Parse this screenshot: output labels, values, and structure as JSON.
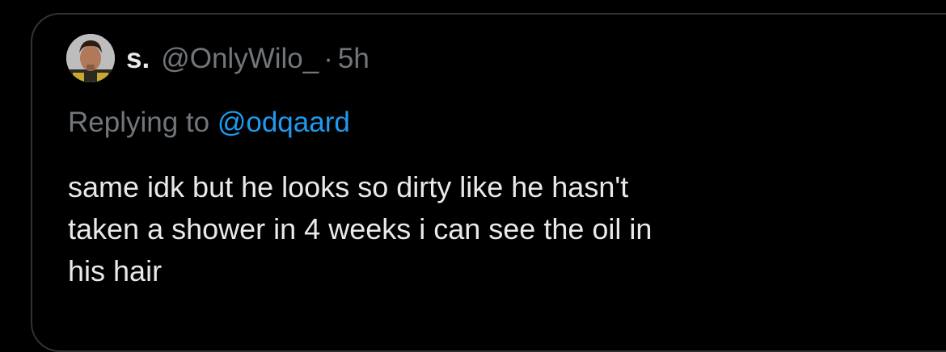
{
  "tweet": {
    "display_name": "s.",
    "handle": "@OnlyWilo_",
    "separator": "·",
    "time": "5h",
    "reply_prefix": "Replying to",
    "reply_to": "@odqaard",
    "text_lines": [
      "same idk but he looks so dirty like he hasn't",
      "taken a shower in 4 weeks i can see the oil in",
      "his hair"
    ]
  },
  "colors": {
    "background": "#000000",
    "primary_text": "#e7e9ea",
    "secondary_text": "#71767b",
    "link": "#1d9bf0",
    "border": "#2f3336"
  }
}
